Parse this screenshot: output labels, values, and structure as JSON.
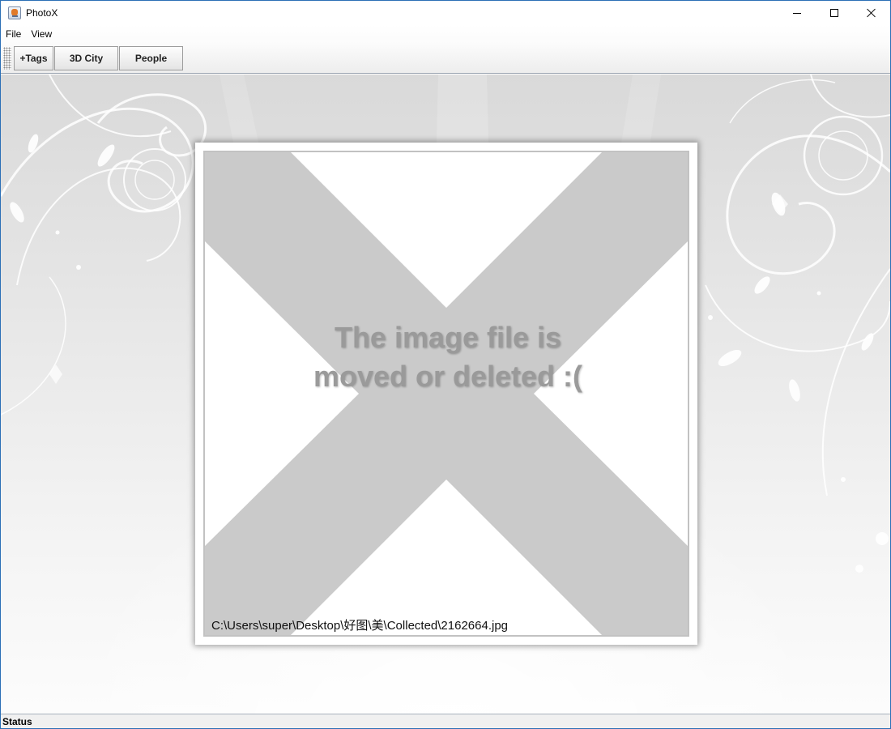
{
  "window": {
    "title": "PhotoX",
    "controls": [
      "minimize-icon",
      "maximize-icon",
      "close-icon"
    ]
  },
  "menubar": {
    "items": [
      {
        "label": "File"
      },
      {
        "label": "View"
      }
    ]
  },
  "toolbar": {
    "buttons": [
      {
        "label": "+Tags"
      },
      {
        "label": "3D City"
      },
      {
        "label": "People"
      }
    ]
  },
  "viewer": {
    "message_line1": "The image file is",
    "message_line2": "moved or deleted :(",
    "file_path": "C:\\Users\\super\\Desktop\\好图\\美\\Collected\\2162664.jpg",
    "placeholder_color": "#cacaca",
    "placeholder_icon": "broken-image-x-icon"
  },
  "statusbar": {
    "text": "Status"
  },
  "colors": {
    "window_border": "#2b6fb6",
    "message_text": "#9a9a9a"
  }
}
